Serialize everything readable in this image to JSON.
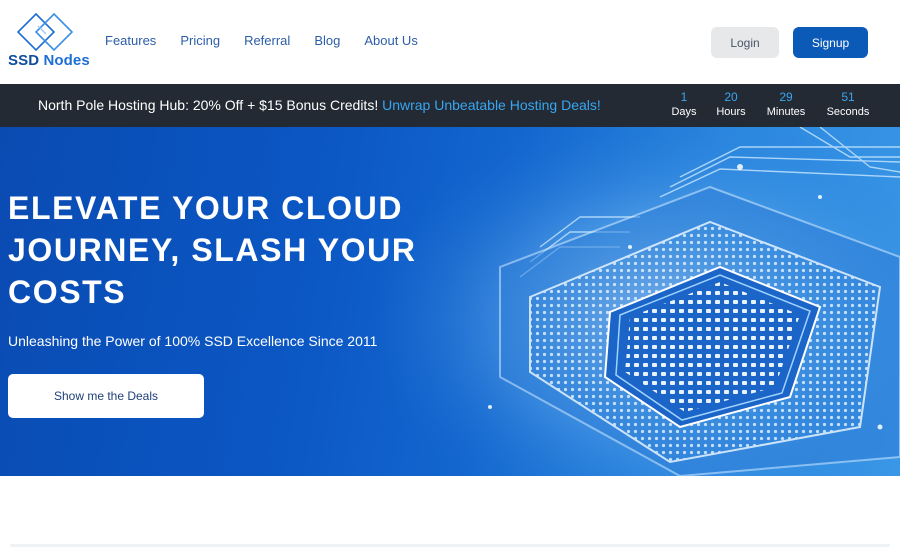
{
  "brand": {
    "name_ssd": "SSD",
    "name_nodes": "Nodes"
  },
  "nav": {
    "items": [
      {
        "label": "Features"
      },
      {
        "label": "Pricing"
      },
      {
        "label": "Referral"
      },
      {
        "label": "Blog"
      },
      {
        "label": "About Us"
      }
    ]
  },
  "auth": {
    "login_label": "Login",
    "signup_label": "Signup"
  },
  "promo": {
    "text": "North Pole Hosting Hub: 20% Off + $15 Bonus Credits! ",
    "link_text": "Unwrap Unbeatable Hosting Deals!",
    "countdown": [
      {
        "value": "1",
        "unit": "Days"
      },
      {
        "value": "20",
        "unit": "Hours"
      },
      {
        "value": "29",
        "unit": "Minutes"
      },
      {
        "value": "51",
        "unit": "Seconds"
      }
    ]
  },
  "hero": {
    "title": "ELEVATE YOUR CLOUD JOURNEY, SLASH YOUR COSTS",
    "subtitle": "Unleashing the Power of 100% SSD Excellence Since 2011",
    "cta_label": "Show me the Deals"
  },
  "colors": {
    "primary": "#0b5ab8",
    "accent": "#38a6f0",
    "promo_bg": "#232a33",
    "hero_bg": "#0b57c4"
  },
  "icons": {
    "logo": "diamond-outline-logo-icon",
    "hero_image": "cpu-chip-illustration"
  }
}
